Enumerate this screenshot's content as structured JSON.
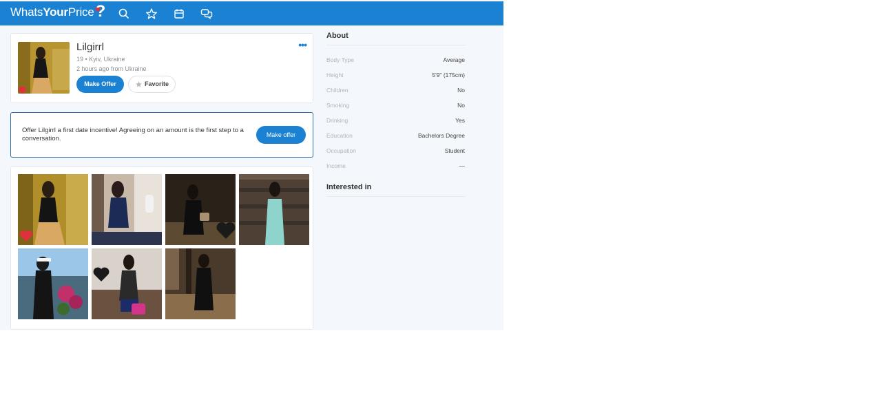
{
  "header": {
    "logo_text_a": "Whats",
    "logo_text_b": "Your",
    "logo_text_c": "Price",
    "logo_mark": "?",
    "nav_icons": [
      "search-icon",
      "star-icon",
      "calendar-icon",
      "chat-icon"
    ],
    "color": "#1b82d3"
  },
  "profile": {
    "name": "Lilgirrl",
    "location": "19 • Kyiv, Ukraine",
    "last_active": "2 hours ago from Ukraine",
    "make_offer_label": "Make Offer",
    "favorite_label": "Favorite",
    "more_label": "•••"
  },
  "offer": {
    "text": "Offer Lilgirrl a first date incentive! Agreeing on an amount is the first step to a conversation.",
    "button_label": "Make offer"
  },
  "about": {
    "title": "About",
    "rows": [
      {
        "key": "Body Type",
        "value": "Average"
      },
      {
        "key": "Height",
        "value": "5'9\" (175cm)"
      },
      {
        "key": "Children",
        "value": "No"
      },
      {
        "key": "Smoking",
        "value": "No"
      },
      {
        "key": "Drinking",
        "value": "Yes"
      },
      {
        "key": "Education",
        "value": "Bachelors Degree"
      },
      {
        "key": "Occupation",
        "value": "Student"
      },
      {
        "key": "Income",
        "value": "—"
      }
    ],
    "interested_title": "Interested in"
  },
  "colors": {
    "accent": "#1b82d3",
    "offer_border": "#2e6da8",
    "heart_red": "#e0303c",
    "heart_black": "#1a1a1a"
  }
}
